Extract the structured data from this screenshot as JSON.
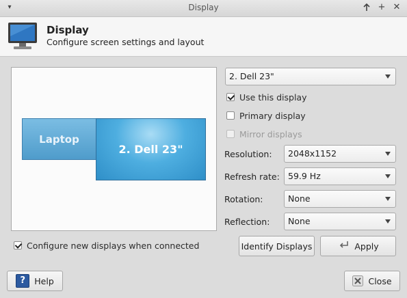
{
  "window": {
    "title": "Display",
    "menu_glyph": "▾",
    "btn_up": "▲",
    "btn_max": "+",
    "btn_close": "✕"
  },
  "header": {
    "title": "Display",
    "subtitle": "Configure screen settings and layout",
    "icon": "monitor-icon"
  },
  "preview": {
    "displays": [
      {
        "label": "Laptop"
      },
      {
        "label": "2. Dell 23\""
      }
    ]
  },
  "settings": {
    "selected_display": "2. Dell 23\"",
    "use_this_display": {
      "label": "Use this display",
      "checked": true
    },
    "primary_display": {
      "label": "Primary display",
      "checked": false
    },
    "mirror_displays": {
      "label": "Mirror displays",
      "checked": false,
      "enabled": false
    },
    "resolution": {
      "label": "Resolution:",
      "value": "2048x1152"
    },
    "refresh_rate": {
      "label": "Refresh rate:",
      "value": "59.9 Hz"
    },
    "rotation": {
      "label": "Rotation:",
      "value": "None"
    },
    "reflection": {
      "label": "Reflection:",
      "value": "None"
    }
  },
  "options": {
    "configure_new": {
      "label": "Configure new displays when connected",
      "checked": true
    }
  },
  "buttons": {
    "identify": "Identify Displays",
    "apply": "Apply",
    "help": "Help",
    "close": "Close"
  },
  "colors": {
    "display_blue": "#4eaee0",
    "help_blue": "#2c5aa0"
  }
}
